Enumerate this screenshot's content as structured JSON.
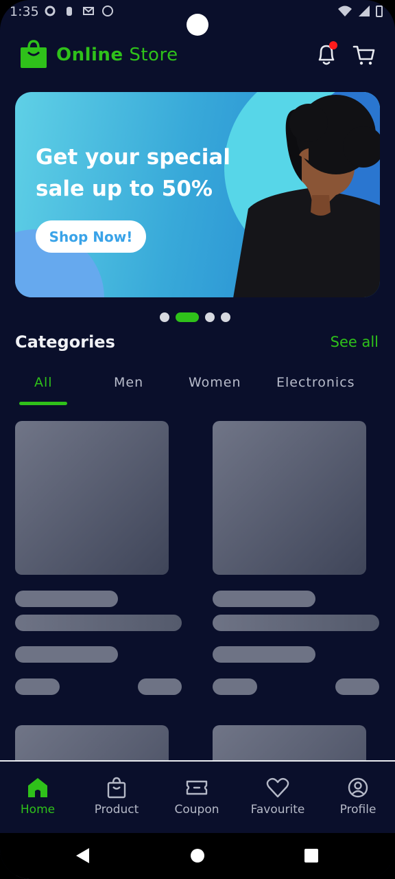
{
  "status": {
    "time": "1:35"
  },
  "header": {
    "brand_bold": "Online",
    "brand_rest": "Store"
  },
  "banner": {
    "title": "Get your special sale up to 50%",
    "button_label": "Shop Now!",
    "active_slide": 2,
    "slide_count": 4
  },
  "categories": {
    "title": "Categories",
    "see_all": "See all",
    "tabs": [
      "All",
      "Men",
      "Women",
      "Electronics"
    ],
    "active_tab": "All"
  },
  "bottom_nav": {
    "items": [
      {
        "label": "Home",
        "icon": "home-icon",
        "active": true
      },
      {
        "label": "Product",
        "icon": "bag-icon",
        "active": false
      },
      {
        "label": "Coupon",
        "icon": "ticket-icon",
        "active": false
      },
      {
        "label": "Favourite",
        "icon": "heart-icon",
        "active": false
      },
      {
        "label": "Profile",
        "icon": "user-circle-icon",
        "active": false
      }
    ]
  },
  "colors": {
    "background": "#0a0f2b",
    "accent": "#2fc11a",
    "notification": "#ff1b1b",
    "banner": "#38a9d9"
  }
}
